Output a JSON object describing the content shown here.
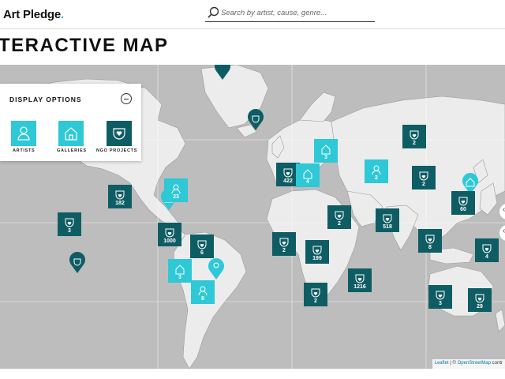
{
  "header": {
    "logo_text": "Art Pledge",
    "logo_dot": ".",
    "search_placeholder": "Search by artist, cause, genre..."
  },
  "page": {
    "title": "TERACTIVE MAP"
  },
  "panel": {
    "title": "DISPLAY OPTIONS",
    "options": [
      {
        "label": "ARTISTS",
        "icon": "person-icon",
        "color": "#2ec8d6"
      },
      {
        "label": "GALLERIES",
        "icon": "house-icon",
        "color": "#2ec8d6"
      },
      {
        "label": "NGO PROJECTS",
        "icon": "heart-shield-icon",
        "color": "#0f5d64"
      }
    ]
  },
  "map": {
    "ocean_color": "#bdbdbd",
    "land_color": "#ececec",
    "clusters": [
      {
        "count": "182",
        "type": "ngo"
      },
      {
        "count": "3",
        "type": "ngo"
      },
      {
        "count": "1000",
        "type": "ngo"
      },
      {
        "count": "6",
        "type": "ngo"
      },
      {
        "count": "3",
        "type": "gallery"
      },
      {
        "count": "8",
        "type": "artist"
      },
      {
        "count": "23",
        "type": "artist"
      },
      {
        "count": "422",
        "type": "ngo"
      },
      {
        "count": "4",
        "type": "gallery"
      },
      {
        "count": "3",
        "type": "gallery"
      },
      {
        "count": "2",
        "type": "ngo"
      },
      {
        "count": "2",
        "type": "artist"
      },
      {
        "count": "2",
        "type": "ngo"
      },
      {
        "count": "199",
        "type": "ngo"
      },
      {
        "count": "2",
        "type": "ngo"
      },
      {
        "count": "1216",
        "type": "ngo"
      },
      {
        "count": "518",
        "type": "ngo"
      },
      {
        "count": "8",
        "type": "ngo"
      },
      {
        "count": "2",
        "type": "ngo"
      },
      {
        "count": "2",
        "type": "ngo"
      },
      {
        "count": "60",
        "type": "ngo"
      },
      {
        "count": "4",
        "type": "ngo"
      },
      {
        "count": "3",
        "type": "ngo"
      },
      {
        "count": "29",
        "type": "ngo"
      }
    ],
    "attribution_leaflet": "Leaflet",
    "attribution_sep": " | © ",
    "attribution_osm": "OpenStreetMap",
    "attribution_rest": " contr",
    "colors": {
      "ngo": "#0f5d64",
      "artist": "#2ec8d6",
      "gallery": "#2ec8d6"
    }
  }
}
